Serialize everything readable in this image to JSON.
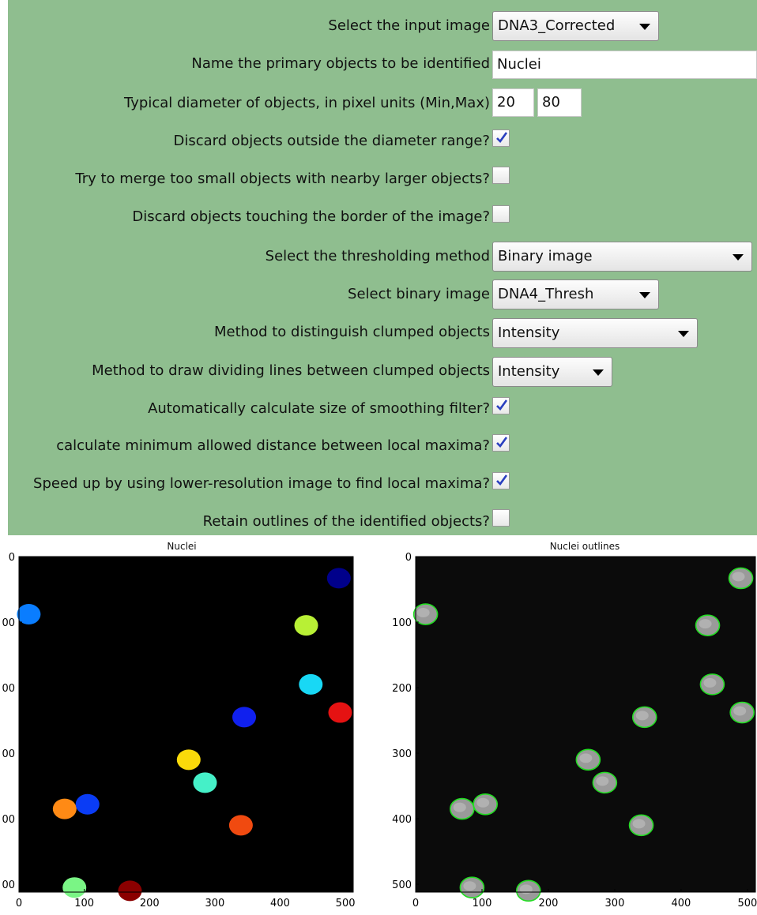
{
  "settings": {
    "input_image": {
      "label": "Select the input image",
      "value": "DNA3_Corrected"
    },
    "primary_objects": {
      "label": "Name the primary objects to be identified",
      "value": "Nuclei"
    },
    "diameter": {
      "label": "Typical diameter of objects, in pixel units (Min,Max)",
      "min": "20",
      "max": "80"
    },
    "discard_outside": {
      "label": "Discard objects outside the diameter range?",
      "checked": true
    },
    "merge_small": {
      "label": "Try to merge too small objects with nearby larger objects?",
      "checked": false
    },
    "discard_border": {
      "label": "Discard objects touching the border of the image?",
      "checked": false
    },
    "threshold_method": {
      "label": "Select the thresholding method",
      "value": "Binary image"
    },
    "binary_image": {
      "label": "Select binary image",
      "value": "DNA4_Thresh"
    },
    "distinguish_method": {
      "label": "Method to distinguish clumped objects",
      "value": "Intensity"
    },
    "dividing_lines_method": {
      "label": "Method to draw dividing lines between clumped objects",
      "value": "Intensity"
    },
    "auto_smoothing": {
      "label": "Automatically calculate size of smoothing filter?",
      "checked": true
    },
    "min_distance": {
      "label": "calculate minimum allowed distance between local maxima?",
      "checked": true
    },
    "speed_up": {
      "label": "Speed up by using lower-resolution image to find local maxima?",
      "checked": true
    },
    "retain_outlines": {
      "label": "Retain outlines of the identified objects?",
      "checked": false
    }
  },
  "left_plot": {
    "title": "Nuclei",
    "x_ticks": [
      "0",
      "100",
      "200",
      "300",
      "400",
      "500"
    ],
    "y_ticks": [
      "0",
      "00",
      "00",
      "00",
      "00",
      "00"
    ]
  },
  "right_plot": {
    "title": "Nuclei outlines",
    "x_ticks": [
      "0",
      "100",
      "200",
      "300",
      "400",
      "500"
    ],
    "y_ticks": [
      "0",
      "100",
      "200",
      "300",
      "400",
      "500"
    ]
  },
  "nuclei": [
    {
      "x": 15,
      "y": 88,
      "color": "#0a7dff"
    },
    {
      "x": 490,
      "y": 33,
      "color": "#00008b"
    },
    {
      "x": 440,
      "y": 105,
      "color": "#b8f035"
    },
    {
      "x": 447,
      "y": 195,
      "color": "#18d8f5"
    },
    {
      "x": 345,
      "y": 245,
      "color": "#1020ee"
    },
    {
      "x": 492,
      "y": 238,
      "color": "#e51212"
    },
    {
      "x": 260,
      "y": 310,
      "color": "#fada0a"
    },
    {
      "x": 285,
      "y": 345,
      "color": "#45f0c8"
    },
    {
      "x": 70,
      "y": 385,
      "color": "#ff8a15"
    },
    {
      "x": 105,
      "y": 378,
      "color": "#0a3cf5"
    },
    {
      "x": 340,
      "y": 410,
      "color": "#f04a10"
    },
    {
      "x": 85,
      "y": 505,
      "color": "#7af585"
    },
    {
      "x": 170,
      "y": 510,
      "color": "#8b0000"
    }
  ]
}
